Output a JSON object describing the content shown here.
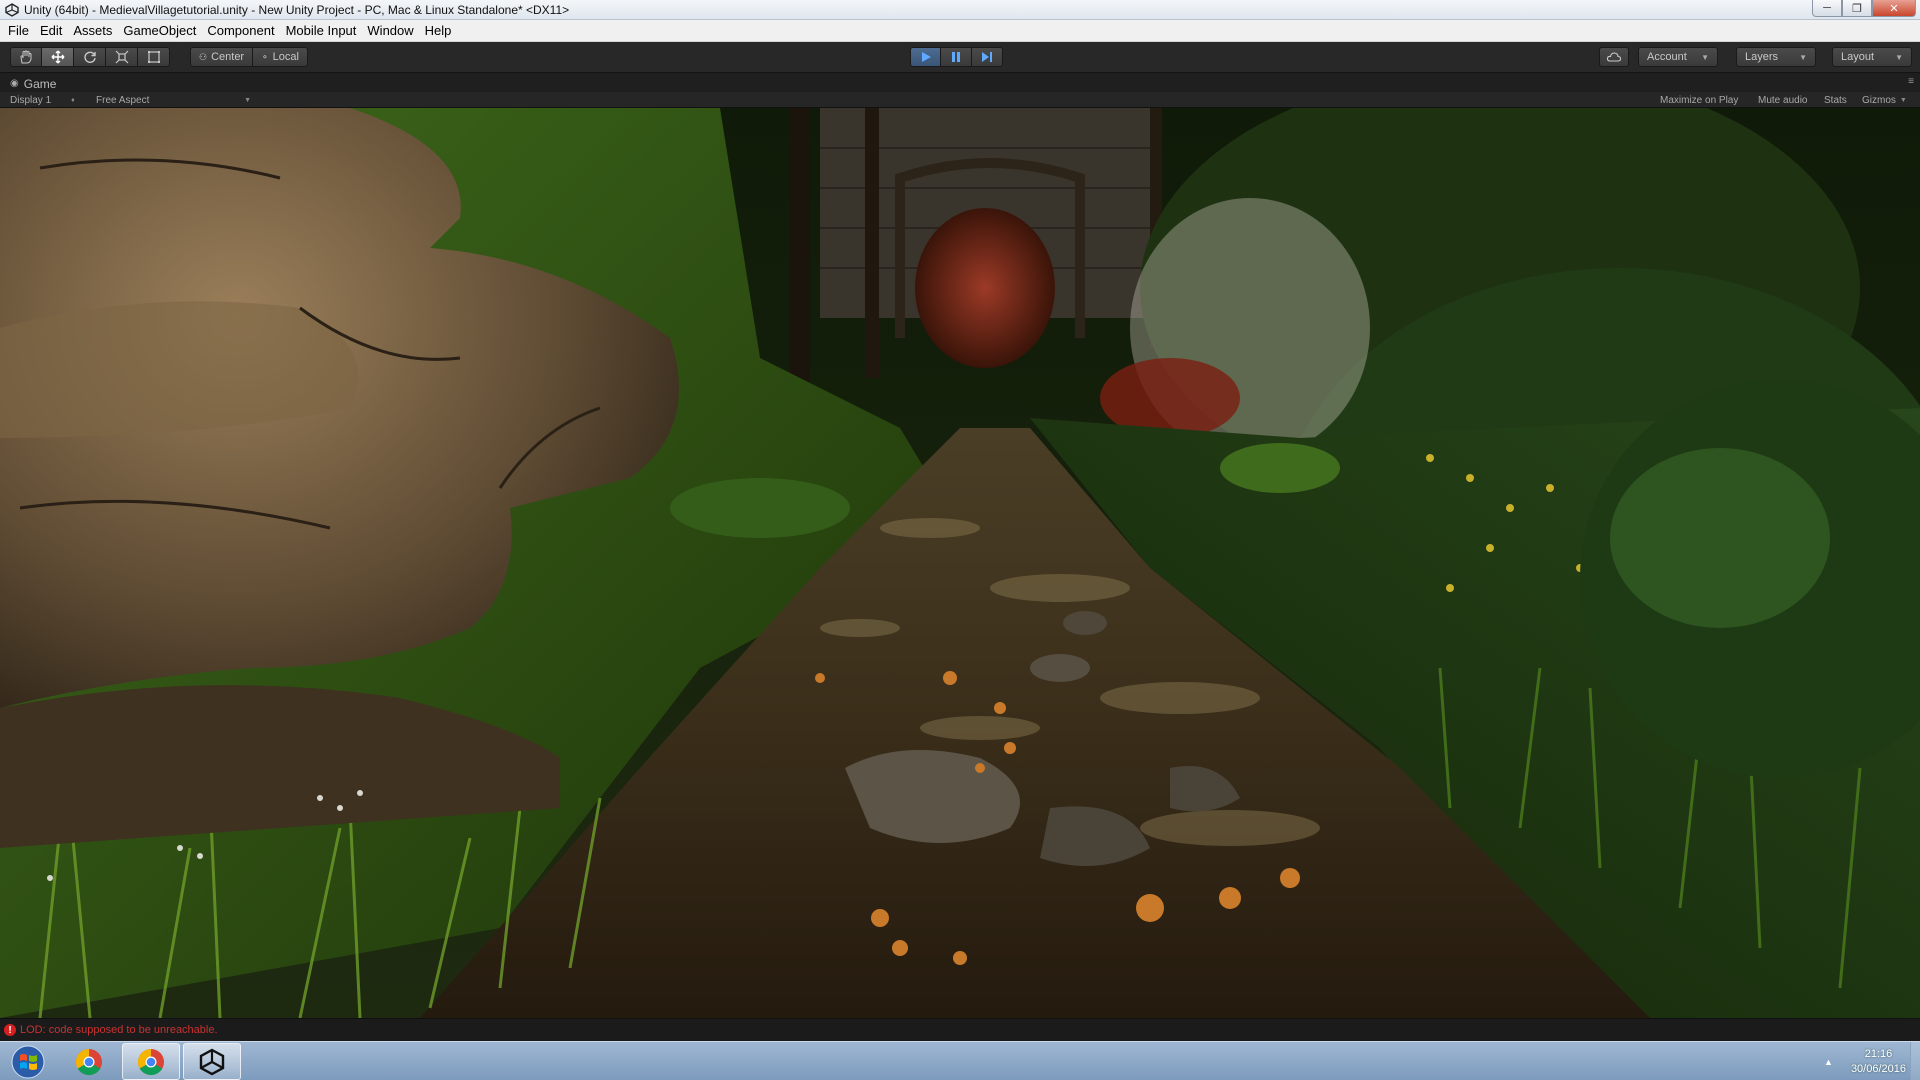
{
  "window": {
    "title": "Unity (64bit) - MedievalVillagetutorial.unity - New Unity Project - PC, Mac & Linux Standalone* <DX11>",
    "icon": "unity-icon"
  },
  "menu": {
    "items": [
      {
        "label": "File"
      },
      {
        "label": "Edit"
      },
      {
        "label": "Assets"
      },
      {
        "label": "GameObject"
      },
      {
        "label": "Component"
      },
      {
        "label": "Mobile Input"
      },
      {
        "label": "Window"
      },
      {
        "label": "Help"
      }
    ]
  },
  "toolbar": {
    "transform_tools": [
      "hand-tool-icon",
      "move-tool-icon",
      "rotate-tool-icon",
      "scale-tool-icon",
      "rect-tool-icon"
    ],
    "active_tool": "move-tool-icon",
    "pivot_label": "Center",
    "space_label": "Local",
    "playback": {
      "play": "play-icon",
      "pause": "pause-icon",
      "step": "step-icon",
      "playing": true
    },
    "account_label": "Account",
    "layers_label": "Layers",
    "layout_label": "Layout"
  },
  "game_view": {
    "tab_label": "Game",
    "display_label": "Display 1",
    "aspect_label": "Free Aspect",
    "maximize_label": "Maximize on Play",
    "mute_label": "Mute audio",
    "stats_label": "Stats",
    "gizmos_label": "Gizmos"
  },
  "status": {
    "message": "LOD: code supposed to be unreachable."
  },
  "taskbar": {
    "time": "21:16",
    "date": "30/06/2016"
  },
  "colors": {
    "unity_dark": "#282828",
    "play_active": "#4d6c91",
    "error_red": "#c83232",
    "taskbar_blue": "#7d9bbd"
  }
}
